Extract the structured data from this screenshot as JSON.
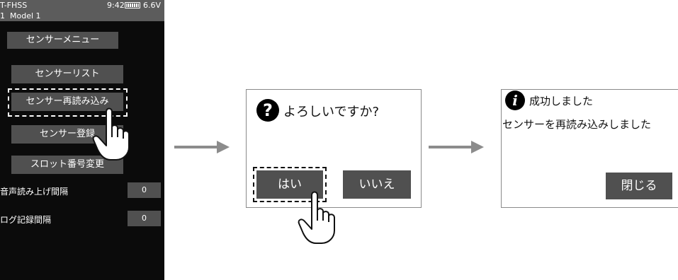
{
  "device": {
    "status": {
      "protocol": "T-FHSS",
      "time": "9:42",
      "voltage": "6.6V",
      "battery_icon": "battery-icon"
    },
    "model": {
      "number": "1",
      "name": "Model 1"
    },
    "menu_title": "センサーメニュー",
    "buttons": {
      "sensor_list": "センサーリスト",
      "sensor_reload": "センサー再読み込み",
      "sensor_register": "センサー登録",
      "slot_change": "スロット番号変更"
    },
    "settings": [
      {
        "label": "音声読み上げ間隔",
        "value": "0"
      },
      {
        "label": "ログ記録間隔",
        "value": "0"
      }
    ]
  },
  "confirm_dialog": {
    "icon": "question-icon",
    "icon_glyph": "?",
    "title": "よろしいですか?",
    "yes": "はい",
    "no": "いいえ"
  },
  "success_dialog": {
    "icon": "info-icon",
    "icon_glyph": "i",
    "title": "成功しました",
    "message": "センサーを再読み込みしました",
    "close": "閉じる"
  },
  "colors": {
    "screen_bg": "#0b0b0b",
    "button_bg": "#505050",
    "header_bg": "#5c5c5c",
    "arrow": "#8c8c8c"
  }
}
